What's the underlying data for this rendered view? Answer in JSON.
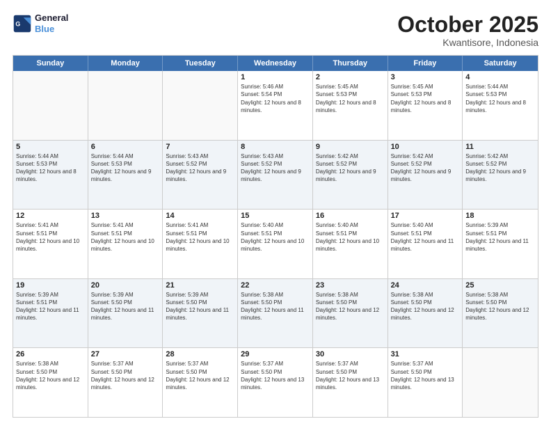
{
  "logo": {
    "text_general": "General",
    "text_blue": "Blue"
  },
  "header": {
    "month": "October 2025",
    "location": "Kwantisore, Indonesia"
  },
  "weekdays": [
    "Sunday",
    "Monday",
    "Tuesday",
    "Wednesday",
    "Thursday",
    "Friday",
    "Saturday"
  ],
  "rows": [
    {
      "alt": false,
      "cells": [
        {
          "day": "",
          "sunrise": "",
          "sunset": "",
          "daylight": ""
        },
        {
          "day": "",
          "sunrise": "",
          "sunset": "",
          "daylight": ""
        },
        {
          "day": "",
          "sunrise": "",
          "sunset": "",
          "daylight": ""
        },
        {
          "day": "1",
          "sunrise": "Sunrise: 5:46 AM",
          "sunset": "Sunset: 5:54 PM",
          "daylight": "Daylight: 12 hours and 8 minutes."
        },
        {
          "day": "2",
          "sunrise": "Sunrise: 5:45 AM",
          "sunset": "Sunset: 5:53 PM",
          "daylight": "Daylight: 12 hours and 8 minutes."
        },
        {
          "day": "3",
          "sunrise": "Sunrise: 5:45 AM",
          "sunset": "Sunset: 5:53 PM",
          "daylight": "Daylight: 12 hours and 8 minutes."
        },
        {
          "day": "4",
          "sunrise": "Sunrise: 5:44 AM",
          "sunset": "Sunset: 5:53 PM",
          "daylight": "Daylight: 12 hours and 8 minutes."
        }
      ]
    },
    {
      "alt": true,
      "cells": [
        {
          "day": "5",
          "sunrise": "Sunrise: 5:44 AM",
          "sunset": "Sunset: 5:53 PM",
          "daylight": "Daylight: 12 hours and 8 minutes."
        },
        {
          "day": "6",
          "sunrise": "Sunrise: 5:44 AM",
          "sunset": "Sunset: 5:53 PM",
          "daylight": "Daylight: 12 hours and 9 minutes."
        },
        {
          "day": "7",
          "sunrise": "Sunrise: 5:43 AM",
          "sunset": "Sunset: 5:52 PM",
          "daylight": "Daylight: 12 hours and 9 minutes."
        },
        {
          "day": "8",
          "sunrise": "Sunrise: 5:43 AM",
          "sunset": "Sunset: 5:52 PM",
          "daylight": "Daylight: 12 hours and 9 minutes."
        },
        {
          "day": "9",
          "sunrise": "Sunrise: 5:42 AM",
          "sunset": "Sunset: 5:52 PM",
          "daylight": "Daylight: 12 hours and 9 minutes."
        },
        {
          "day": "10",
          "sunrise": "Sunrise: 5:42 AM",
          "sunset": "Sunset: 5:52 PM",
          "daylight": "Daylight: 12 hours and 9 minutes."
        },
        {
          "day": "11",
          "sunrise": "Sunrise: 5:42 AM",
          "sunset": "Sunset: 5:52 PM",
          "daylight": "Daylight: 12 hours and 9 minutes."
        }
      ]
    },
    {
      "alt": false,
      "cells": [
        {
          "day": "12",
          "sunrise": "Sunrise: 5:41 AM",
          "sunset": "Sunset: 5:51 PM",
          "daylight": "Daylight: 12 hours and 10 minutes."
        },
        {
          "day": "13",
          "sunrise": "Sunrise: 5:41 AM",
          "sunset": "Sunset: 5:51 PM",
          "daylight": "Daylight: 12 hours and 10 minutes."
        },
        {
          "day": "14",
          "sunrise": "Sunrise: 5:41 AM",
          "sunset": "Sunset: 5:51 PM",
          "daylight": "Daylight: 12 hours and 10 minutes."
        },
        {
          "day": "15",
          "sunrise": "Sunrise: 5:40 AM",
          "sunset": "Sunset: 5:51 PM",
          "daylight": "Daylight: 12 hours and 10 minutes."
        },
        {
          "day": "16",
          "sunrise": "Sunrise: 5:40 AM",
          "sunset": "Sunset: 5:51 PM",
          "daylight": "Daylight: 12 hours and 10 minutes."
        },
        {
          "day": "17",
          "sunrise": "Sunrise: 5:40 AM",
          "sunset": "Sunset: 5:51 PM",
          "daylight": "Daylight: 12 hours and 11 minutes."
        },
        {
          "day": "18",
          "sunrise": "Sunrise: 5:39 AM",
          "sunset": "Sunset: 5:51 PM",
          "daylight": "Daylight: 12 hours and 11 minutes."
        }
      ]
    },
    {
      "alt": true,
      "cells": [
        {
          "day": "19",
          "sunrise": "Sunrise: 5:39 AM",
          "sunset": "Sunset: 5:51 PM",
          "daylight": "Daylight: 12 hours and 11 minutes."
        },
        {
          "day": "20",
          "sunrise": "Sunrise: 5:39 AM",
          "sunset": "Sunset: 5:50 PM",
          "daylight": "Daylight: 12 hours and 11 minutes."
        },
        {
          "day": "21",
          "sunrise": "Sunrise: 5:39 AM",
          "sunset": "Sunset: 5:50 PM",
          "daylight": "Daylight: 12 hours and 11 minutes."
        },
        {
          "day": "22",
          "sunrise": "Sunrise: 5:38 AM",
          "sunset": "Sunset: 5:50 PM",
          "daylight": "Daylight: 12 hours and 11 minutes."
        },
        {
          "day": "23",
          "sunrise": "Sunrise: 5:38 AM",
          "sunset": "Sunset: 5:50 PM",
          "daylight": "Daylight: 12 hours and 12 minutes."
        },
        {
          "day": "24",
          "sunrise": "Sunrise: 5:38 AM",
          "sunset": "Sunset: 5:50 PM",
          "daylight": "Daylight: 12 hours and 12 minutes."
        },
        {
          "day": "25",
          "sunrise": "Sunrise: 5:38 AM",
          "sunset": "Sunset: 5:50 PM",
          "daylight": "Daylight: 12 hours and 12 minutes."
        }
      ]
    },
    {
      "alt": false,
      "cells": [
        {
          "day": "26",
          "sunrise": "Sunrise: 5:38 AM",
          "sunset": "Sunset: 5:50 PM",
          "daylight": "Daylight: 12 hours and 12 minutes."
        },
        {
          "day": "27",
          "sunrise": "Sunrise: 5:37 AM",
          "sunset": "Sunset: 5:50 PM",
          "daylight": "Daylight: 12 hours and 12 minutes."
        },
        {
          "day": "28",
          "sunrise": "Sunrise: 5:37 AM",
          "sunset": "Sunset: 5:50 PM",
          "daylight": "Daylight: 12 hours and 12 minutes."
        },
        {
          "day": "29",
          "sunrise": "Sunrise: 5:37 AM",
          "sunset": "Sunset: 5:50 PM",
          "daylight": "Daylight: 12 hours and 13 minutes."
        },
        {
          "day": "30",
          "sunrise": "Sunrise: 5:37 AM",
          "sunset": "Sunset: 5:50 PM",
          "daylight": "Daylight: 12 hours and 13 minutes."
        },
        {
          "day": "31",
          "sunrise": "Sunrise: 5:37 AM",
          "sunset": "Sunset: 5:50 PM",
          "daylight": "Daylight: 12 hours and 13 minutes."
        },
        {
          "day": "",
          "sunrise": "",
          "sunset": "",
          "daylight": ""
        }
      ]
    }
  ]
}
